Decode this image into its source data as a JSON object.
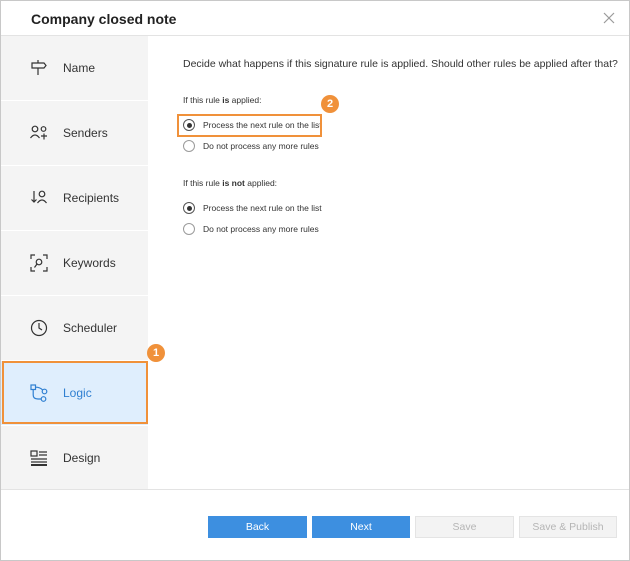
{
  "dialog": {
    "title": "Company closed note"
  },
  "sidebar": {
    "items": [
      {
        "label": "Name",
        "icon": "signpost-icon"
      },
      {
        "label": "Senders",
        "icon": "senders-icon"
      },
      {
        "label": "Recipients",
        "icon": "recipients-icon"
      },
      {
        "label": "Keywords",
        "icon": "keywords-icon"
      },
      {
        "label": "Scheduler",
        "icon": "clock-icon"
      },
      {
        "label": "Logic",
        "icon": "logic-flow-icon",
        "active": true
      },
      {
        "label": "Design",
        "icon": "design-icon"
      }
    ]
  },
  "content": {
    "description": "Decide what happens if this signature rule is applied. Should other rules be applied after that?",
    "applied": {
      "prefix": "If this rule ",
      "emphasis": "is",
      "suffix": " applied:",
      "options": [
        "Process the next rule on the list",
        "Do not process any more rules"
      ],
      "selected": 0
    },
    "not_applied": {
      "prefix": "If this rule ",
      "emphasis": "is not",
      "suffix": " applied:",
      "options": [
        "Process the next rule on the list",
        "Do not process any more rules"
      ],
      "selected": 0
    }
  },
  "annotations": {
    "badge_1": "1",
    "badge_2": "2",
    "highlight_color": "#f0913a"
  },
  "footer": {
    "back": "Back",
    "next": "Next",
    "save": "Save",
    "save_publish": "Save & Publish"
  },
  "colors": {
    "primary": "#3d8fe0",
    "active_bg": "#dfeefd",
    "active_text": "#2f7fd1"
  }
}
